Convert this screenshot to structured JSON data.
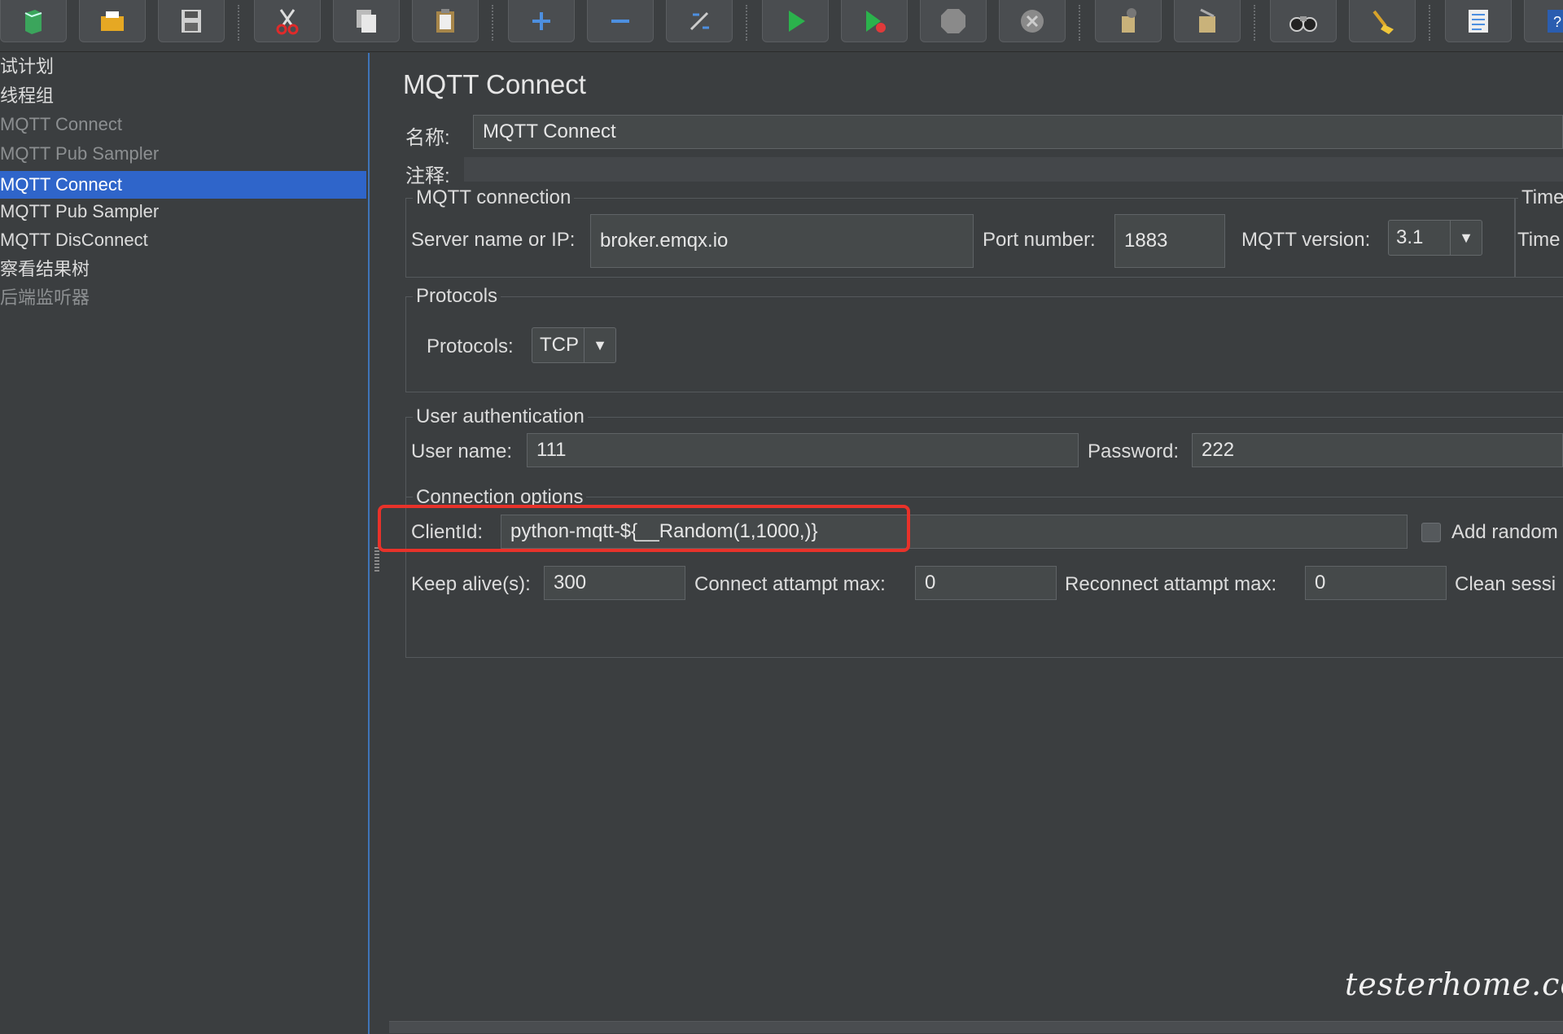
{
  "toolbar": {
    "buttons": [
      {
        "name": "new-icon"
      },
      {
        "name": "open-icon"
      },
      {
        "name": "save-icon"
      },
      {
        "name": "cut-icon"
      },
      {
        "name": "copy-icon"
      },
      {
        "name": "paste-icon"
      },
      {
        "name": "expand-icon"
      },
      {
        "name": "collapse-icon"
      },
      {
        "name": "toggle-icon"
      },
      {
        "name": "start-icon"
      },
      {
        "name": "start-no-pauses-icon"
      },
      {
        "name": "stop-icon"
      },
      {
        "name": "shutdown-icon"
      },
      {
        "name": "clear-icon"
      },
      {
        "name": "clear-all-icon"
      },
      {
        "name": "search-icon"
      },
      {
        "name": "reset-search-icon"
      },
      {
        "name": "function-helper-icon"
      },
      {
        "name": "help-icon"
      }
    ]
  },
  "tree": {
    "items": [
      {
        "label": "试计划",
        "state": "normal"
      },
      {
        "label": "线程组",
        "state": "normal"
      },
      {
        "label": "MQTT Connect",
        "state": "disabled"
      },
      {
        "label": "MQTT Pub Sampler",
        "state": "disabled"
      },
      {
        "label": "MQTT Connect",
        "state": "selected"
      },
      {
        "label": "MQTT Pub Sampler",
        "state": "normal"
      },
      {
        "label": "MQTT DisConnect",
        "state": "normal"
      },
      {
        "label": "察看结果树",
        "state": "normal"
      },
      {
        "label": "后端监听器",
        "state": "disabled"
      }
    ]
  },
  "panel": {
    "title": "MQTT Connect",
    "name_label": "名称:",
    "name_value": "MQTT Connect",
    "comment_label": "注释:",
    "comment_value": "",
    "mqtt_connection": {
      "group_title": "MQTT connection",
      "server_label": "Server name or IP:",
      "server_value": "broker.emqx.io",
      "port_label": "Port number:",
      "port_value": "1883",
      "version_label": "MQTT version:",
      "version_value": "3.1",
      "timeout_group_title": "Time",
      "timeout_label": "Time"
    },
    "protocols": {
      "group_title": "Protocols",
      "label": "Protocols:",
      "value": "TCP"
    },
    "user_auth": {
      "group_title": "User authentication",
      "username_label": "User name:",
      "username_value": "111",
      "password_label": "Password:",
      "password_value": "222"
    },
    "connection_options": {
      "group_title": "Connection options",
      "clientid_label": "ClientId:",
      "clientid_value": "python-mqtt-${__Random(1,1000,)}",
      "add_random_label": "Add random",
      "keepalive_label": "Keep alive(s):",
      "keepalive_value": "300",
      "connect_max_label": "Connect attampt max:",
      "connect_max_value": "0",
      "reconnect_max_label": "Reconnect attampt max:",
      "reconnect_max_value": "0",
      "clean_session_label": "Clean sessi"
    }
  },
  "watermark": "testerhome.com",
  "colors": {
    "selection": "#2f65ca",
    "highlight": "#e8322a",
    "background": "#3b3e40"
  }
}
